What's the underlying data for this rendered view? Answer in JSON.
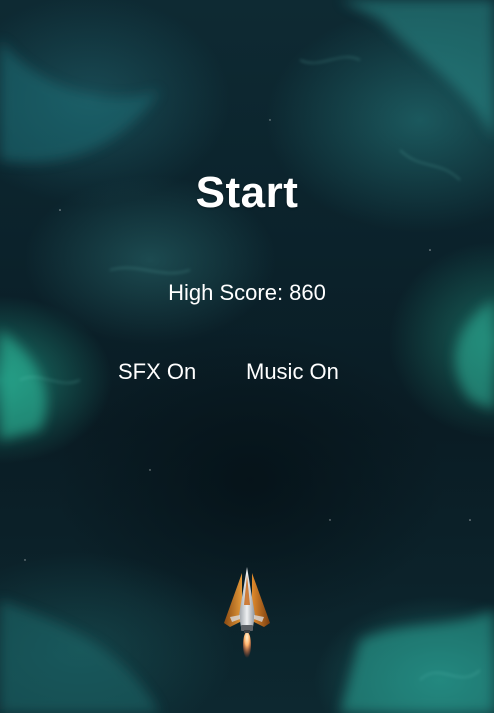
{
  "menu": {
    "start_label": "Start",
    "high_score_label": "High Score: 860",
    "sfx_toggle_label": "SFX On",
    "music_toggle_label": "Music On"
  },
  "player_ship": {
    "icon": "spaceship-icon"
  },
  "colors": {
    "text": "#ffffff",
    "background_deep": "#0a1c24",
    "nebula_teal": "#2abf9f",
    "ship_orange": "#e08a2c",
    "ship_silver": "#c9cdd2",
    "thruster_flame": "#ff7a3c"
  }
}
